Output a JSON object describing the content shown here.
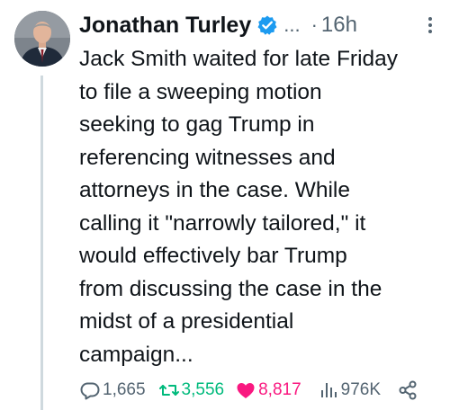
{
  "tweet": {
    "author_name": "Jonathan Turley",
    "ellipsis": "...",
    "separator": "·",
    "time": "16h",
    "lines": [
      "Jack Smith waited for late Friday",
      "to file a sweeping motion",
      "seeking to gag Trump in",
      "referencing witnesses and",
      "attorneys in the case. While",
      "calling it \"narrowly tailored,\" it",
      "would effectively bar Trump",
      "from discussing the case in the",
      "midst of a presidential",
      "campaign..."
    ]
  },
  "actions": {
    "replies": "1,665",
    "reposts": "3,556",
    "likes": "8,817",
    "views": "976K"
  },
  "colors": {
    "text": "#0f1419",
    "muted": "#536471",
    "verified": "#1d9bf0",
    "repost": "#00ba7c",
    "like": "#f91880",
    "thread_line": "#cfd9de"
  },
  "icons": [
    "avatar",
    "verified-badge-icon",
    "more-options-icon",
    "reply-icon",
    "repost-icon",
    "like-icon",
    "views-icon",
    "share-icon"
  ]
}
